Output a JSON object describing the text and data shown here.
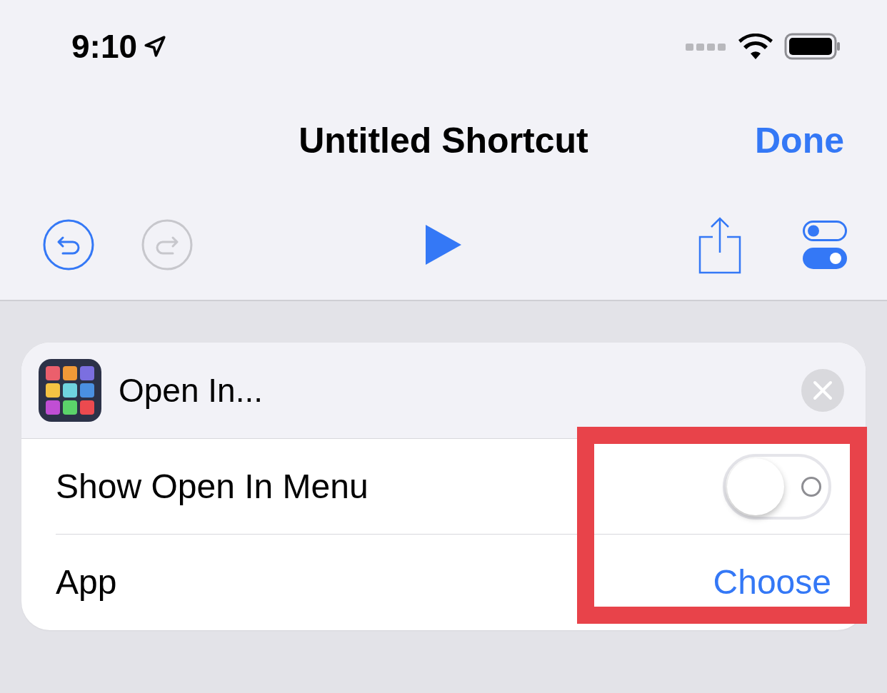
{
  "status_bar": {
    "time": "9:10"
  },
  "nav": {
    "title": "Untitled Shortcut",
    "done": "Done"
  },
  "toolbar": {
    "undo_enabled": true,
    "redo_enabled": false
  },
  "action": {
    "title": "Open In...",
    "rows": [
      {
        "kind": "toggle",
        "label": "Show Open In Menu",
        "on": false
      },
      {
        "kind": "choice",
        "label": "App",
        "value": "Choose"
      }
    ]
  },
  "highlight": {
    "shown": true
  }
}
